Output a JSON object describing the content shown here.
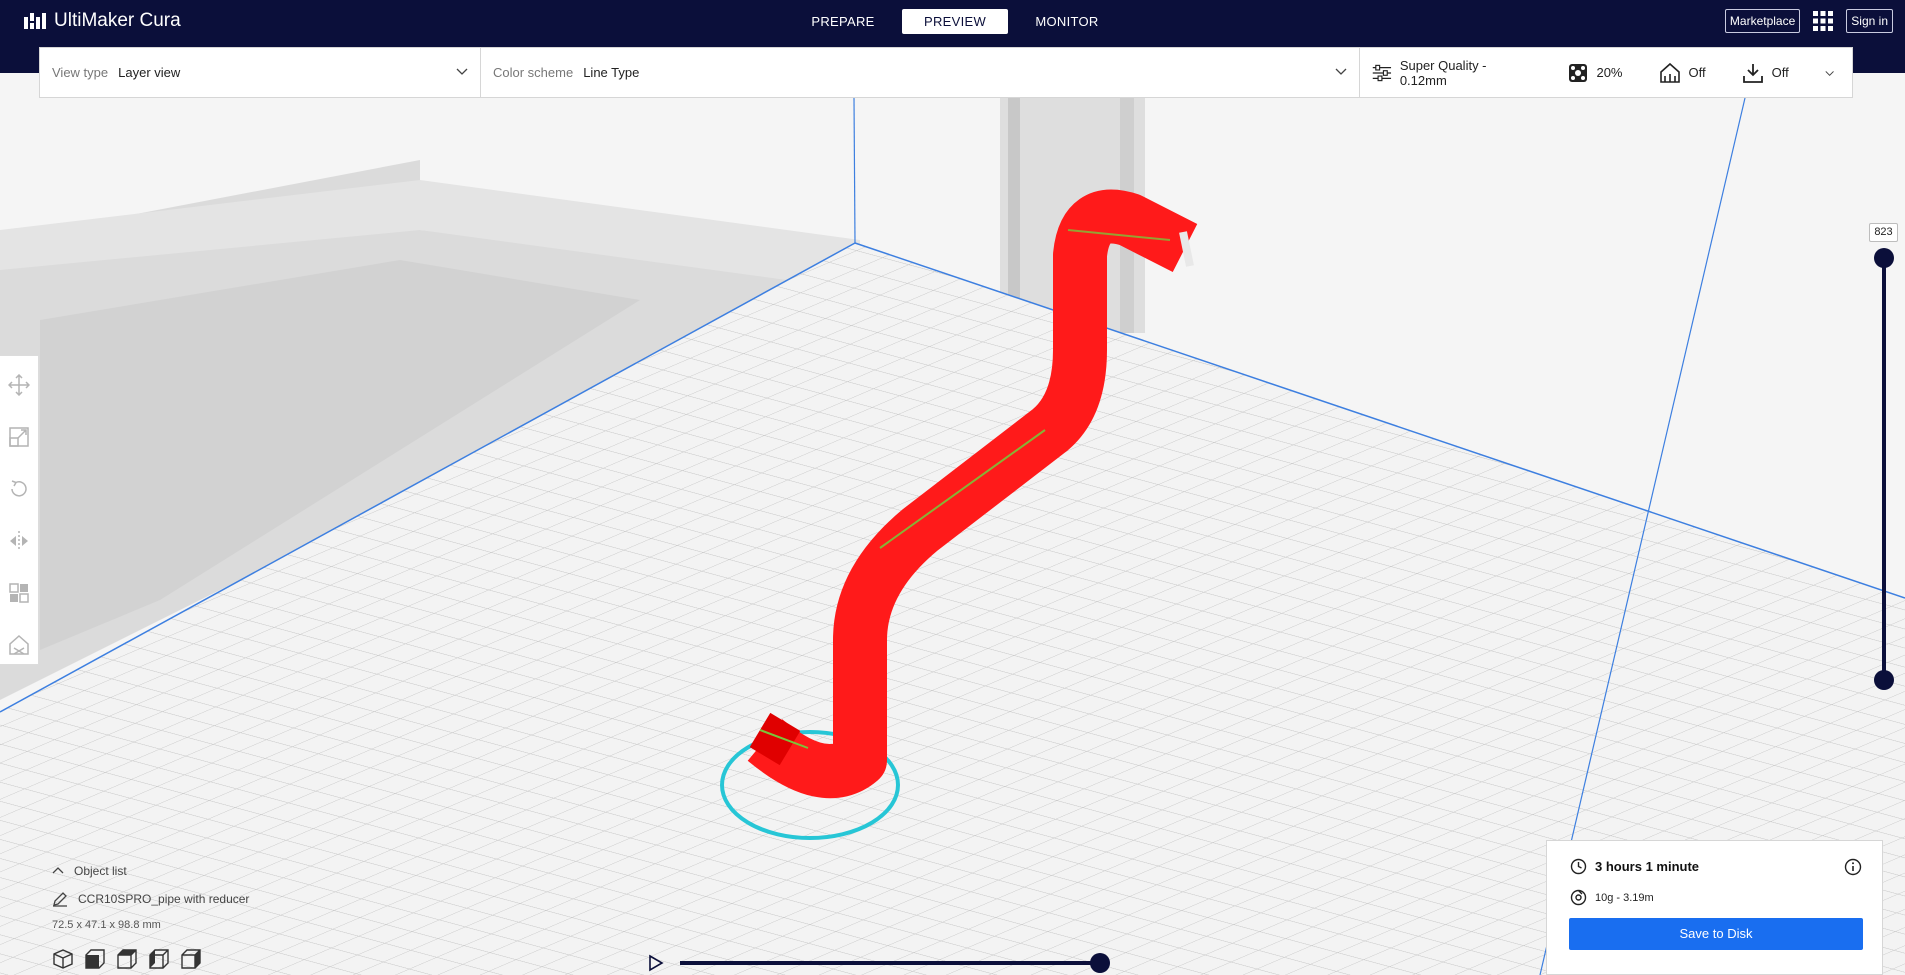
{
  "app": {
    "title": "UltiMaker Cura"
  },
  "stages": [
    {
      "label": "PREPARE",
      "active": false
    },
    {
      "label": "PREVIEW",
      "active": true
    },
    {
      "label": "MONITOR",
      "active": false
    }
  ],
  "top_right": {
    "marketplace": "Marketplace",
    "sign_in": "Sign in"
  },
  "view": {
    "view_type_label": "View type",
    "view_type_value": "Layer view",
    "color_scheme_label": "Color scheme",
    "color_scheme_value": "Line Type"
  },
  "print_settings": {
    "profile": "Super Quality - 0.12mm",
    "infill": "20%",
    "support": "Off",
    "adhesion": "Off"
  },
  "layer_slider": {
    "current_layer": "823"
  },
  "object_list": {
    "header": "Object list",
    "object_name": "CCR10SPRO_pipe with reducer",
    "dimensions": "72.5 x 47.1 x 98.8 mm"
  },
  "print_info": {
    "time": "3 hours 1 minute",
    "material": "10g - 3.19m",
    "save_label": "Save to Disk"
  },
  "colors": {
    "topbar": "#0b0f3a",
    "accent": "#196ef0",
    "model": "#ff1a1a",
    "skirt": "#27c6d6"
  }
}
